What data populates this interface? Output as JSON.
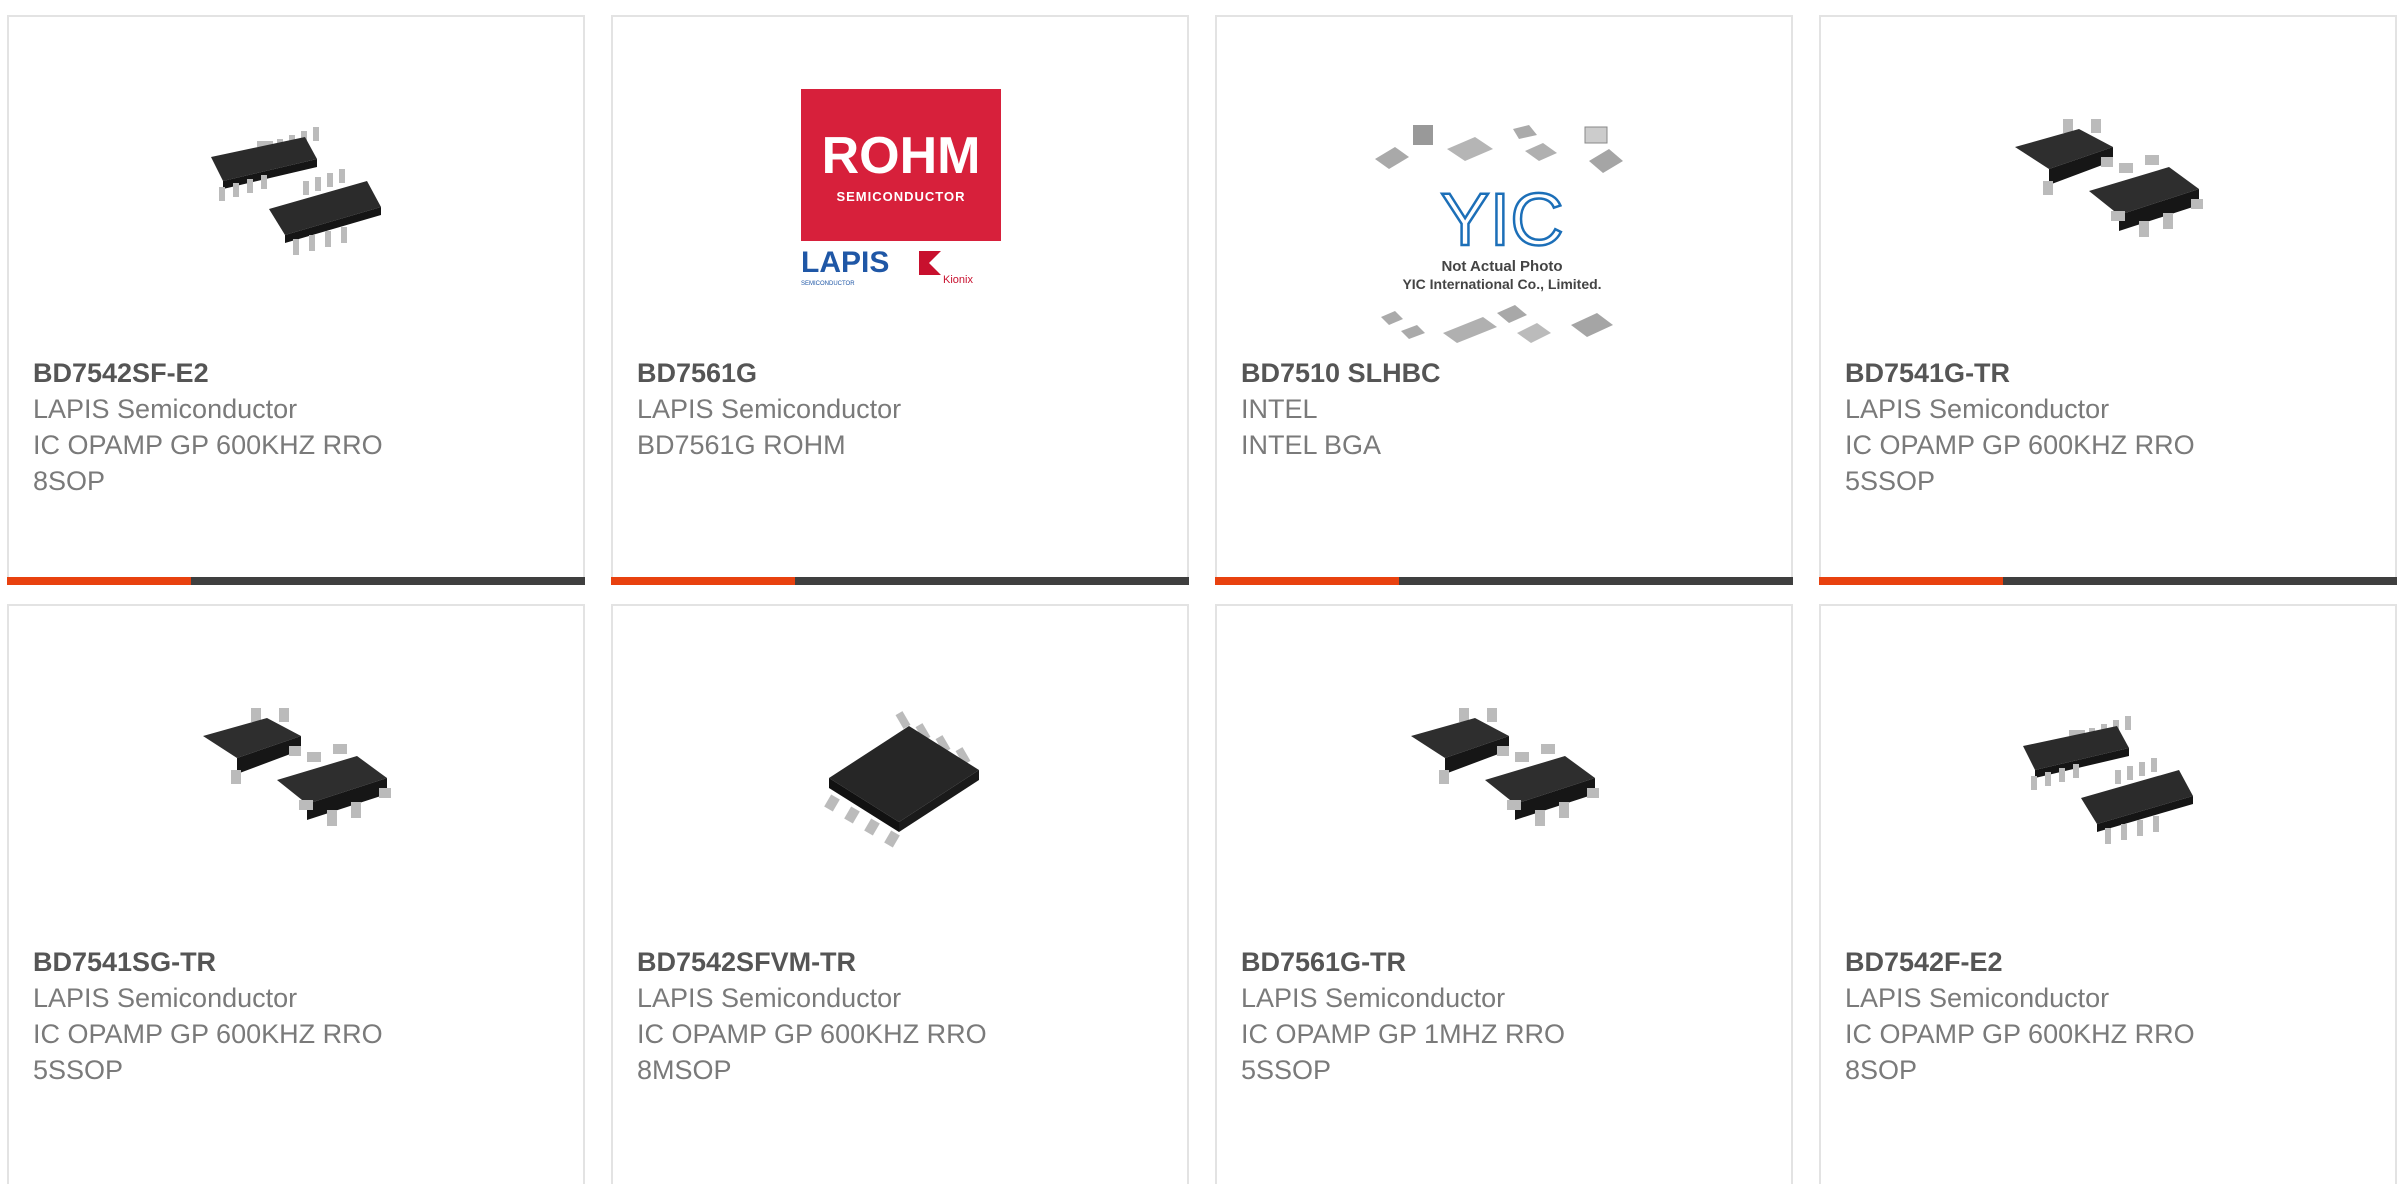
{
  "products": [
    {
      "part": "BD7542SF-E2",
      "mfr": "LAPIS Semiconductor",
      "desc": "IC OPAMP GP 600KHZ RRO\n8SOP",
      "image": "chip-8sop-icon"
    },
    {
      "part": "BD7561G",
      "mfr": "LAPIS Semiconductor",
      "desc": "BD7561G ROHM",
      "image": "rohm-lapis-logo",
      "logo": {
        "brand": "ROHM",
        "brand_sub": "SEMICONDUCTOR",
        "sub1": "LAPIS",
        "sub1_small": "SEMICONDUCTOR",
        "sub2": "Kionix"
      }
    },
    {
      "part": "BD7510 SLHBC",
      "mfr": "INTEL",
      "desc": "INTEL BGA",
      "image": "yic-placeholder-icon",
      "placeholder": {
        "mark": "YIC",
        "line1": "Not Actual Photo",
        "line2": "YIC International Co., Limited."
      }
    },
    {
      "part": "BD7541G-TR",
      "mfr": "LAPIS Semiconductor",
      "desc": "IC OPAMP GP 600KHZ RRO\n5SSOP",
      "image": "chip-5ssop-icon"
    },
    {
      "part": "BD7541SG-TR",
      "mfr": "LAPIS Semiconductor",
      "desc": "IC OPAMP GP 600KHZ RRO\n5SSOP",
      "image": "chip-5ssop-icon"
    },
    {
      "part": "BD7542SFVM-TR",
      "mfr": "LAPIS Semiconductor",
      "desc": "IC OPAMP GP 600KHZ RRO\n8MSOP",
      "image": "chip-8msop-icon"
    },
    {
      "part": "BD7561G-TR",
      "mfr": "LAPIS Semiconductor",
      "desc": "IC OPAMP GP 1MHZ RRO\n5SSOP",
      "image": "chip-5ssop-icon"
    },
    {
      "part": "BD7542F-E2",
      "mfr": "LAPIS Semiconductor",
      "desc": "IC OPAMP GP 600KHZ RRO\n8SOP",
      "image": "chip-8sop-icon"
    }
  ],
  "colors": {
    "accent": "#e8410f",
    "bar": "#3f3f3f",
    "rohm_red": "#d7203b",
    "lapis_blue": "#1f57a6"
  }
}
